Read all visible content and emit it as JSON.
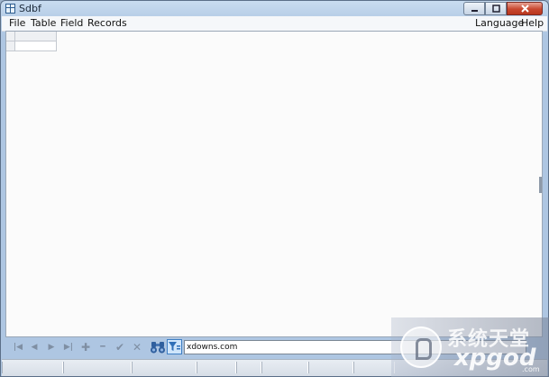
{
  "window": {
    "title": "Sdbf"
  },
  "menubar": {
    "left": [
      "File",
      "Table",
      "Field",
      "Records"
    ],
    "right": [
      "Language",
      "Help"
    ]
  },
  "navigator": {
    "buttons": [
      {
        "name": "first-record-icon",
        "glyph": "|◀"
      },
      {
        "name": "prior-record-icon",
        "glyph": "◀"
      },
      {
        "name": "next-record-icon",
        "glyph": "▶"
      },
      {
        "name": "last-record-icon",
        "glyph": "▶|"
      },
      {
        "name": "insert-record-icon",
        "glyph": "✚"
      },
      {
        "name": "delete-record-icon",
        "glyph": "━"
      },
      {
        "name": "post-edit-icon",
        "glyph": "✔"
      },
      {
        "name": "cancel-edit-icon",
        "glyph": "✕"
      }
    ]
  },
  "search": {
    "value": "xdowns.com"
  },
  "watermark": {
    "cjk": "系统天堂",
    "latin": "xpgod",
    "com": ".com"
  },
  "colors": {
    "filter_accent": "#3f7fc4",
    "close_button": "#c8472f"
  }
}
